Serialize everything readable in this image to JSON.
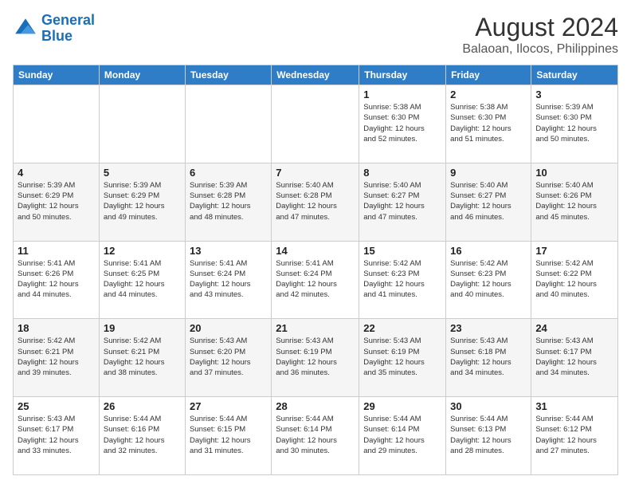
{
  "header": {
    "logo_line1": "General",
    "logo_line2": "Blue",
    "month_year": "August 2024",
    "location": "Balaoan, Ilocos, Philippines"
  },
  "days_of_week": [
    "Sunday",
    "Monday",
    "Tuesday",
    "Wednesday",
    "Thursday",
    "Friday",
    "Saturday"
  ],
  "weeks": [
    [
      {
        "day": "",
        "info": ""
      },
      {
        "day": "",
        "info": ""
      },
      {
        "day": "",
        "info": ""
      },
      {
        "day": "",
        "info": ""
      },
      {
        "day": "1",
        "info": "Sunrise: 5:38 AM\nSunset: 6:30 PM\nDaylight: 12 hours\nand 52 minutes."
      },
      {
        "day": "2",
        "info": "Sunrise: 5:38 AM\nSunset: 6:30 PM\nDaylight: 12 hours\nand 51 minutes."
      },
      {
        "day": "3",
        "info": "Sunrise: 5:39 AM\nSunset: 6:30 PM\nDaylight: 12 hours\nand 50 minutes."
      }
    ],
    [
      {
        "day": "4",
        "info": "Sunrise: 5:39 AM\nSunset: 6:29 PM\nDaylight: 12 hours\nand 50 minutes."
      },
      {
        "day": "5",
        "info": "Sunrise: 5:39 AM\nSunset: 6:29 PM\nDaylight: 12 hours\nand 49 minutes."
      },
      {
        "day": "6",
        "info": "Sunrise: 5:39 AM\nSunset: 6:28 PM\nDaylight: 12 hours\nand 48 minutes."
      },
      {
        "day": "7",
        "info": "Sunrise: 5:40 AM\nSunset: 6:28 PM\nDaylight: 12 hours\nand 47 minutes."
      },
      {
        "day": "8",
        "info": "Sunrise: 5:40 AM\nSunset: 6:27 PM\nDaylight: 12 hours\nand 47 minutes."
      },
      {
        "day": "9",
        "info": "Sunrise: 5:40 AM\nSunset: 6:27 PM\nDaylight: 12 hours\nand 46 minutes."
      },
      {
        "day": "10",
        "info": "Sunrise: 5:40 AM\nSunset: 6:26 PM\nDaylight: 12 hours\nand 45 minutes."
      }
    ],
    [
      {
        "day": "11",
        "info": "Sunrise: 5:41 AM\nSunset: 6:26 PM\nDaylight: 12 hours\nand 44 minutes."
      },
      {
        "day": "12",
        "info": "Sunrise: 5:41 AM\nSunset: 6:25 PM\nDaylight: 12 hours\nand 44 minutes."
      },
      {
        "day": "13",
        "info": "Sunrise: 5:41 AM\nSunset: 6:24 PM\nDaylight: 12 hours\nand 43 minutes."
      },
      {
        "day": "14",
        "info": "Sunrise: 5:41 AM\nSunset: 6:24 PM\nDaylight: 12 hours\nand 42 minutes."
      },
      {
        "day": "15",
        "info": "Sunrise: 5:42 AM\nSunset: 6:23 PM\nDaylight: 12 hours\nand 41 minutes."
      },
      {
        "day": "16",
        "info": "Sunrise: 5:42 AM\nSunset: 6:23 PM\nDaylight: 12 hours\nand 40 minutes."
      },
      {
        "day": "17",
        "info": "Sunrise: 5:42 AM\nSunset: 6:22 PM\nDaylight: 12 hours\nand 40 minutes."
      }
    ],
    [
      {
        "day": "18",
        "info": "Sunrise: 5:42 AM\nSunset: 6:21 PM\nDaylight: 12 hours\nand 39 minutes."
      },
      {
        "day": "19",
        "info": "Sunrise: 5:42 AM\nSunset: 6:21 PM\nDaylight: 12 hours\nand 38 minutes."
      },
      {
        "day": "20",
        "info": "Sunrise: 5:43 AM\nSunset: 6:20 PM\nDaylight: 12 hours\nand 37 minutes."
      },
      {
        "day": "21",
        "info": "Sunrise: 5:43 AM\nSunset: 6:19 PM\nDaylight: 12 hours\nand 36 minutes."
      },
      {
        "day": "22",
        "info": "Sunrise: 5:43 AM\nSunset: 6:19 PM\nDaylight: 12 hours\nand 35 minutes."
      },
      {
        "day": "23",
        "info": "Sunrise: 5:43 AM\nSunset: 6:18 PM\nDaylight: 12 hours\nand 34 minutes."
      },
      {
        "day": "24",
        "info": "Sunrise: 5:43 AM\nSunset: 6:17 PM\nDaylight: 12 hours\nand 34 minutes."
      }
    ],
    [
      {
        "day": "25",
        "info": "Sunrise: 5:43 AM\nSunset: 6:17 PM\nDaylight: 12 hours\nand 33 minutes."
      },
      {
        "day": "26",
        "info": "Sunrise: 5:44 AM\nSunset: 6:16 PM\nDaylight: 12 hours\nand 32 minutes."
      },
      {
        "day": "27",
        "info": "Sunrise: 5:44 AM\nSunset: 6:15 PM\nDaylight: 12 hours\nand 31 minutes."
      },
      {
        "day": "28",
        "info": "Sunrise: 5:44 AM\nSunset: 6:14 PM\nDaylight: 12 hours\nand 30 minutes."
      },
      {
        "day": "29",
        "info": "Sunrise: 5:44 AM\nSunset: 6:14 PM\nDaylight: 12 hours\nand 29 minutes."
      },
      {
        "day": "30",
        "info": "Sunrise: 5:44 AM\nSunset: 6:13 PM\nDaylight: 12 hours\nand 28 minutes."
      },
      {
        "day": "31",
        "info": "Sunrise: 5:44 AM\nSunset: 6:12 PM\nDaylight: 12 hours\nand 27 minutes."
      }
    ]
  ]
}
